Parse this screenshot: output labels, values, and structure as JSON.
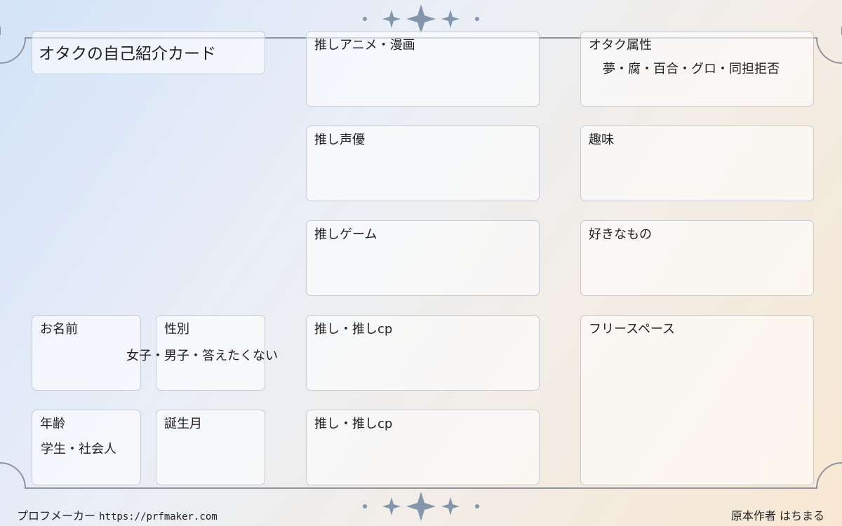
{
  "title": "オタクの自己紹介カード",
  "fields": {
    "name": {
      "label": "お名前"
    },
    "gender": {
      "label": "性別",
      "options": "女子・男子・答えたくない"
    },
    "age": {
      "label": "年齢",
      "options": "学生・社会人"
    },
    "birth_month": {
      "label": "誕生月"
    },
    "anime_manga": {
      "label": "推しアニメ・漫画"
    },
    "voice_actor": {
      "label": "推し声優"
    },
    "game": {
      "label": "推しゲーム"
    },
    "oshi_cp_1": {
      "label": "推し・推しcp"
    },
    "oshi_cp_2": {
      "label": "推し・推しcp"
    },
    "otaku_attributes": {
      "label": "オタク属性",
      "options": "夢・腐・百合・グロ・同担拒否"
    },
    "hobby": {
      "label": "趣味"
    },
    "likes": {
      "label": "好きなもの"
    },
    "free_space": {
      "label": "フリースペース"
    }
  },
  "footer": {
    "maker_label": "プロフメーカー",
    "maker_url": "https://prfmaker.com",
    "author": "原本作者 はちまる"
  },
  "colors": {
    "frame_line": "#8f949e",
    "sparkle": "#8396ab",
    "card_border": "#c5cad3"
  },
  "icons": {
    "top_ornament": "sparkle-ornament-icon",
    "bottom_ornament": "sparkle-ornament-icon"
  }
}
